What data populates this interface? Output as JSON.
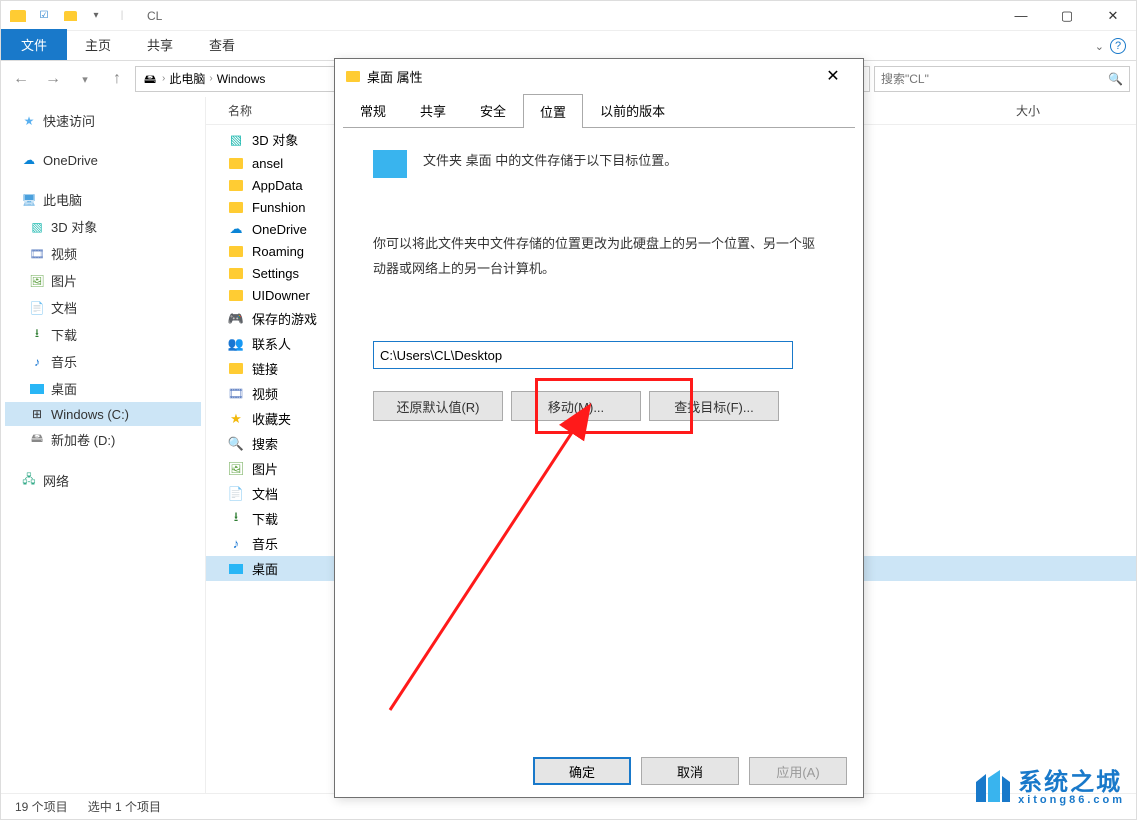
{
  "window": {
    "title": "CL",
    "tabs": {
      "file": "文件",
      "home": "主页",
      "share": "共享",
      "view": "查看"
    }
  },
  "breadcrumb": {
    "pc": "此电脑",
    "drive": "Windows"
  },
  "search": {
    "placeholder": "搜索\"CL\""
  },
  "columns": {
    "name": "名称",
    "size": "大小"
  },
  "tree_root": {
    "quick": "快速访问",
    "onedrive": "OneDrive",
    "pc": "此电脑",
    "net": "网络"
  },
  "tree_pc": [
    "3D 对象",
    "视频",
    "图片",
    "文档",
    "下载",
    "音乐",
    "桌面",
    "Windows (C:)",
    "新加卷 (D:)"
  ],
  "list_items": [
    "3D 对象",
    "ansel",
    "AppData",
    "Funshion",
    "OneDrive",
    "Roaming",
    "Settings",
    "UIDowner",
    "保存的游戏",
    "联系人",
    "链接",
    "视频",
    "收藏夹",
    "搜索",
    "图片",
    "文档",
    "下载",
    "音乐",
    "桌面"
  ],
  "status": {
    "count": "19 个项目",
    "selected": "选中 1 个项目"
  },
  "dialog": {
    "title": "桌面 属性",
    "tabs": {
      "general": "常规",
      "share": "共享",
      "security": "安全",
      "location": "位置",
      "previous": "以前的版本"
    },
    "heading": "文件夹 桌面 中的文件存储于以下目标位置。",
    "desc": "你可以将此文件夹中文件存储的位置更改为此硬盘上的另一个位置、另一个驱动器或网络上的另一台计算机。",
    "path": "C:\\Users\\CL\\Desktop",
    "restore": "还原默认值(R)",
    "move": "移动(M)...",
    "find": "查找目标(F)...",
    "ok": "确定",
    "cancel": "取消",
    "apply": "应用(A)"
  },
  "watermark": {
    "cn": "系统之城",
    "en": "xitong86.com"
  }
}
